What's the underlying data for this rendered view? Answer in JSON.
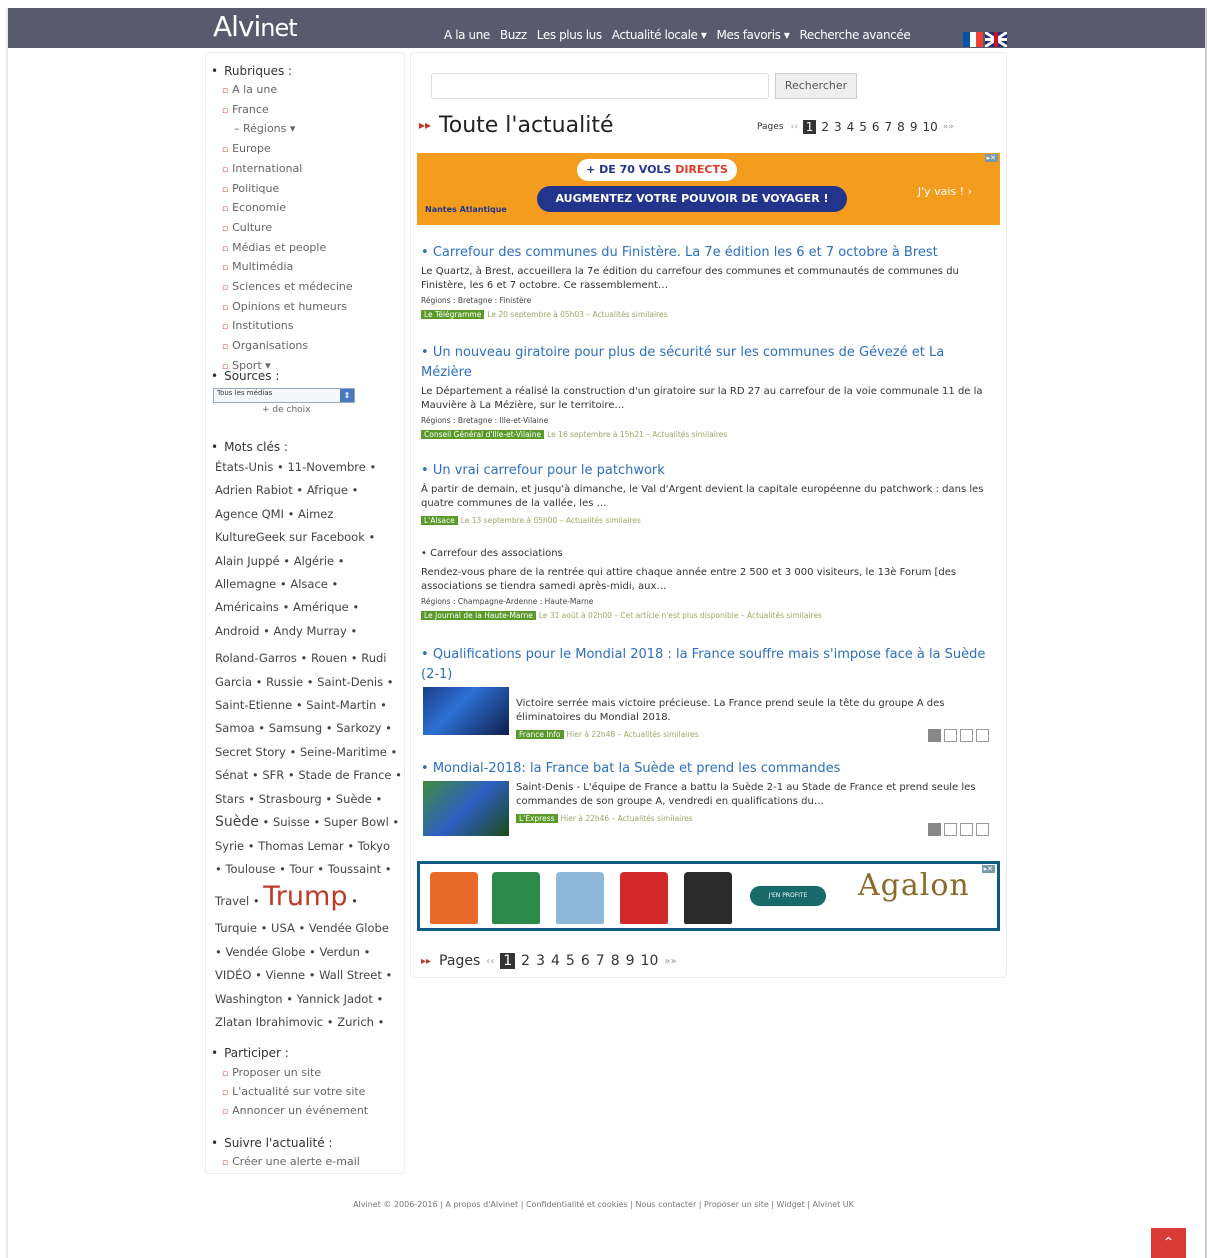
{
  "header": {
    "logo_main": "Alvi",
    "logo_suffix": "net",
    "nav": [
      "A la une",
      "Buzz",
      "Les plus lus",
      "Actualité locale ▾",
      "Mes favoris ▾",
      "Recherche avancée"
    ]
  },
  "sidebar": {
    "rubriques_title": "Rubriques :",
    "rubriques": [
      "A la une",
      "France",
      "– Régions ▾",
      "Europe",
      "International",
      "Politique",
      "Economie",
      "Culture",
      "Médias et people",
      "Multimédia",
      "Sciences et médecine",
      "Opinions et humeurs",
      "Institutions",
      "Organisations",
      "Sport ▾"
    ],
    "sources_title": "Sources :",
    "sources_select": "Tous les médias",
    "sources_more": "+ de choix",
    "motscles_title": "Mots clés :",
    "tags": [
      "États-Unis • 11-Novembre •",
      "Adrien Rabiot • Afrique •",
      "Agence QMI • Aimez",
      "KultureGeek sur Facebook •",
      "Alain Juppé • Algérie •",
      "Allemagne • Alsace •",
      "Américains • Amérique •",
      "Android • Andy Murray •",
      "",
      "Roland-Garros • Rouen • Rudi",
      "Garcia • Russie • Saint-Denis •",
      "Saint-Etienne • Saint-Martin •",
      "Samoa • Samsung • Sarkozy •",
      "Secret Story • Seine-Maritime •",
      "Sénat • SFR • Stade de France •",
      "Stars • Strasbourg • Suède •"
    ],
    "tag_suede": "Suède",
    "tag_suede_rest": " • Suisse • Super Bowl •",
    "tags2": [
      "Syrie • Thomas Lemar • Tokyo",
      "• Toulouse • Tour • Toussaint •"
    ],
    "tag_travel": "Travel •",
    "tag_trump": "Trump",
    "tag_trump_after": " •",
    "tags3": [
      "Turquie • USA • Vendée Globe",
      "• Vendée Globe • Verdun •",
      "VIDÉO • Vienne • Wall Street •",
      "Washington • Yannick Jadot •",
      "Zlatan Ibrahimovic • Zurich •"
    ],
    "participer_title": "Participer :",
    "participer": [
      "Proposer un site",
      "L'actualité sur votre site",
      "Annoncer un événement"
    ],
    "suivre_title": "Suivre l'actualité :",
    "suivre": [
      "Créer une alerte e-mail"
    ]
  },
  "main": {
    "search_button": "Rechercher",
    "title": "Toute l'actualité",
    "pages_label": "Pages",
    "pages": [
      "1",
      "2",
      "3",
      "4",
      "5",
      "6",
      "7",
      "8",
      "9",
      "10"
    ],
    "ad1": {
      "line1_a": "+ DE 70 VOLS ",
      "line1_b": "DIRECTS",
      "line2": "AUGMENTEZ VOTRE POUVOIR DE VOYAGER !",
      "cta": "J'y vais ! ›",
      "sponsor": "Nantes Atlantique"
    },
    "articles": [
      {
        "title": "Carrefour des communes du Finistère. La 7e édition les 6 et 7 octobre à Brest",
        "desc": "Le Quartz, à Brest, accueillera la 7e édition du carrefour des communes et communautés de communes du Finistère, les 6 et 7 octobre. Ce rassemblement…",
        "regions": "Régions : Bretagne : Finistère",
        "source": "Le Télégramme",
        "meta": "Le 20 septembre à 05h03 – Actualités similaires"
      },
      {
        "title": "Un nouveau giratoire pour plus de sécurité sur les communes de Gévezé et La Mézière",
        "desc": "Le Département a réalisé la construction d'un giratoire sur la RD 27 au carrefour de la voie communale 11 de la Mauvière à La Mézière, sur le territoire…",
        "regions": "Régions : Bretagne : Ille-et-Vilaine",
        "source": "Conseil Général d'Ille-et-Vilaine",
        "meta": "Le 16 septembre à 15h21 – Actualités similaires"
      },
      {
        "title": "Un vrai carrefour pour le patchwork",
        "desc": "À partir de demain, et jusqu'à dimanche, le Val d'Argent devient la capitale européenne du patchwork : dans les quatre communes de la vallée, les …",
        "source": "L'Alsace",
        "meta": "Le 13 septembre à 05h00 – Actualités similaires"
      },
      {
        "title": "Carrefour des associations",
        "desc": "Rendez-vous phare de la rentrée qui attire chaque année entre 2 500 et 3 000 visiteurs, le 13è Forum [des associations se tiendra samedi après-midi, aux…",
        "regions": "Régions : Champagne-Ardenne : Haute-Marne",
        "source": "Le Journal de la Haute-Marne",
        "meta": "Le 31 août à 02h00 – Cet article n'est plus disponible – Actualités similaires"
      },
      {
        "title": "Qualifications pour le Mondial 2018 : la France souffre mais s'impose face à la Suède (2-1)",
        "desc": "Victoire serrée mais victoire précieuse. La France prend seule la tête du groupe A des éliminatoires du Mondial 2018.",
        "source": "France Info",
        "meta": "Hier à 22h48 – Actualités similaires"
      },
      {
        "title": "Mondial-2018: la France bat la Suède et prend les commandes",
        "desc": "Saint-Denis - L'équipe de France a battu la Suède 2-1 au Stade de France et prend seule les commandes de son groupe A, vendredi en qualifications du…",
        "source": "L'Express",
        "meta": "Hier à 22h46 – Actualités similaires"
      }
    ],
    "ad2": {
      "cta": "J'EN PROFITE",
      "brand": "Agalon"
    }
  },
  "footer": {
    "text": "Alvinet © 2006-2016 | A propos d'Alvinet | Confidentialité et cookies | Nous contacter | Proposer un site | Widget | Alvinet UK"
  },
  "colors": {
    "header_bg": "#5a5a6e",
    "link": "#2c6fbf",
    "accent": "#c0392b",
    "source_badge": "#5a9a2a",
    "ad1_bg": "#f39c1e"
  }
}
